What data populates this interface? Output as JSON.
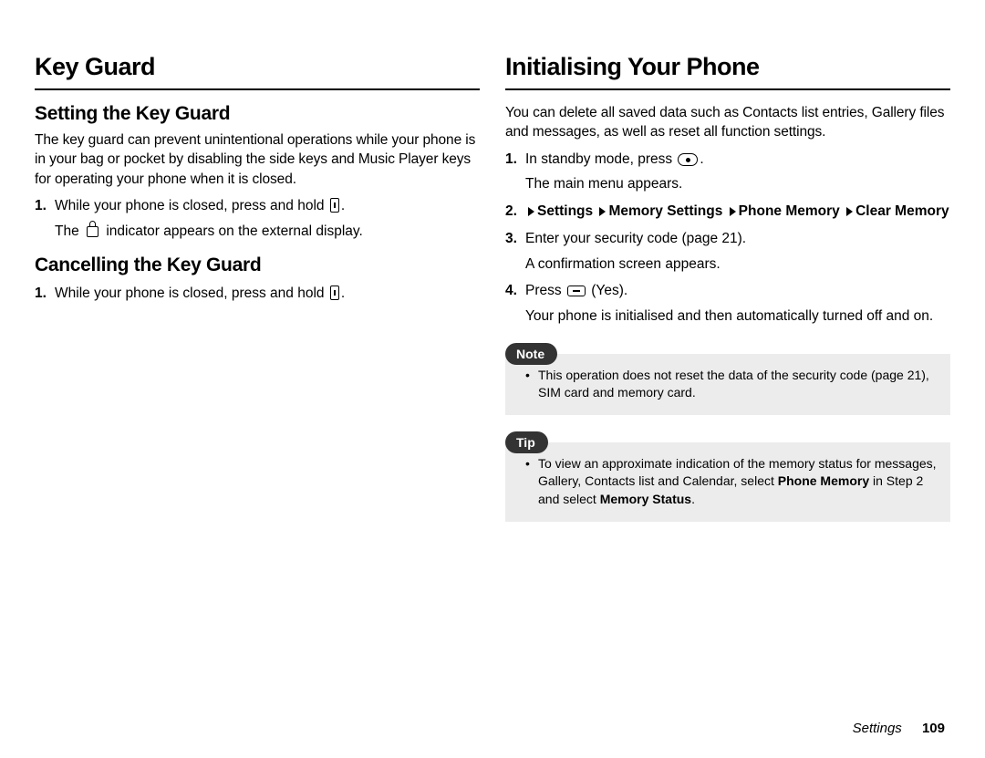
{
  "left": {
    "heading": "Key Guard",
    "sec1": {
      "title": "Setting the Key Guard",
      "intro": "The key guard can prevent unintentional operations while your phone is in your bag or pocket by disabling the side keys and Music Player keys for operating your phone when it is closed.",
      "step1_a": "While your phone is closed, press and hold ",
      "step1_b": ".",
      "step1_sub_a": "The ",
      "step1_sub_b": " indicator appears on the external display."
    },
    "sec2": {
      "title": "Cancelling the Key Guard",
      "step1_a": "While your phone is closed, press and hold ",
      "step1_b": "."
    }
  },
  "right": {
    "heading": "Initialising Your Phone",
    "intro": "You can delete all saved data such as Contacts list entries, Gallery files and messages, as well as reset all function settings.",
    "step1_a": "In standby mode, press ",
    "step1_b": ".",
    "step1_sub": "The main menu appears.",
    "step2_path": [
      "Settings",
      "Memory Settings",
      "Phone Memory",
      "Clear Memory"
    ],
    "step3": "Enter your security code (page 21).",
    "step3_sub": "A confirmation screen appears.",
    "step4_a": "Press ",
    "step4_b": " (Yes).",
    "step4_sub": "Your phone is initialised and then automatically turned off and on.",
    "note_label": "Note",
    "note_text": "This operation does not reset the data of the security code (page 21), SIM card and memory card.",
    "tip_label": "Tip",
    "tip_a": "To view an approximate indication of the memory status for messages, Gallery, Contacts list and Calendar, select ",
    "tip_b": "Phone Memory",
    "tip_c": " in Step 2 and select ",
    "tip_d": "Memory Status",
    "tip_e": "."
  },
  "footer": {
    "section": "Settings",
    "page": "109"
  }
}
